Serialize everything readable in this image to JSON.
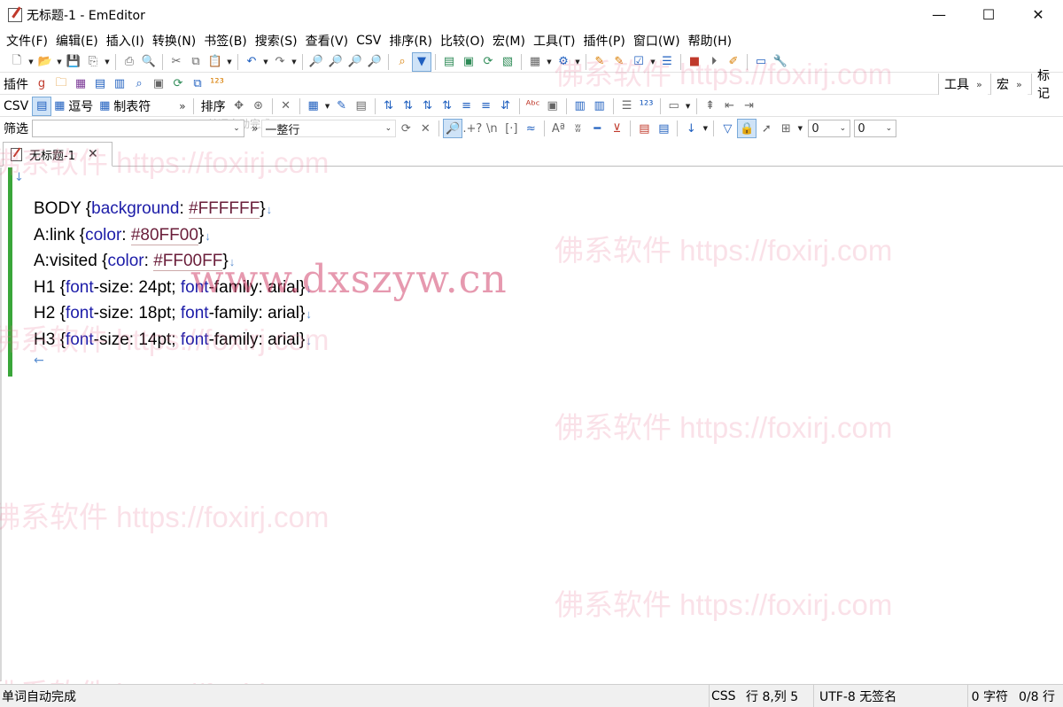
{
  "window": {
    "title": "无标题-1 - EmEditor",
    "minimize": "—",
    "maximize": "☐",
    "close": "✕"
  },
  "menu": [
    "文件(F)",
    "编辑(E)",
    "插入(I)",
    "转换(N)",
    "书签(B)",
    "搜索(S)",
    "查看(V)",
    "CSV",
    "排序(R)",
    "比较(O)",
    "宏(M)",
    "工具(T)",
    "插件(P)",
    "窗口(W)",
    "帮助(H)"
  ],
  "toolbars": {
    "plugins_label": "插件",
    "csv_label": "CSV",
    "comma_label": "逗号",
    "tab_label": "制表符",
    "sort_label": "排序",
    "filter_label": "筛选",
    "filter_mode": "一整行",
    "combo_value_1": "0",
    "combo_value_2": "0",
    "ghost_hint": "单词自动完成",
    "right_tabs": [
      "工具",
      "宏",
      "标记"
    ]
  },
  "document": {
    "tab_title": "无标题-1",
    "lines": [
      {
        "selector": "BODY ",
        "open": "{",
        "parts": [
          {
            "t": "prop",
            "v": "background"
          },
          {
            "t": "plain",
            "v": ": "
          },
          {
            "t": "hex",
            "v": "#FFFFFF"
          }
        ],
        "close": "}"
      },
      {
        "selector": "A:link ",
        "open": "{",
        "parts": [
          {
            "t": "prop",
            "v": "color"
          },
          {
            "t": "plain",
            "v": ": "
          },
          {
            "t": "hex",
            "v": "#80FF00"
          }
        ],
        "close": "}"
      },
      {
        "selector": "A:visited ",
        "open": "{",
        "parts": [
          {
            "t": "prop",
            "v": "color"
          },
          {
            "t": "plain",
            "v": ": "
          },
          {
            "t": "hex",
            "v": "#FF00FF"
          }
        ],
        "close": "}"
      },
      {
        "selector": "H1 ",
        "open": "{",
        "parts": [
          {
            "t": "prop",
            "v": "font"
          },
          {
            "t": "plain",
            "v": "-size: 24pt; "
          },
          {
            "t": "prop",
            "v": "font"
          },
          {
            "t": "plain",
            "v": "-family: arial"
          }
        ],
        "close": "}"
      },
      {
        "selector": "H2 ",
        "open": "{",
        "parts": [
          {
            "t": "prop",
            "v": "font"
          },
          {
            "t": "plain",
            "v": "-size: 18pt; "
          },
          {
            "t": "prop",
            "v": "font"
          },
          {
            "t": "plain",
            "v": "-family: arial"
          }
        ],
        "close": "}"
      },
      {
        "selector": "H3 ",
        "open": "{",
        "parts": [
          {
            "t": "prop",
            "v": "font"
          },
          {
            "t": "plain",
            "v": "-size: 14pt; "
          },
          {
            "t": "prop",
            "v": "font"
          },
          {
            "t": "plain",
            "v": "-family: arial"
          }
        ],
        "close": "}"
      }
    ],
    "eol_glyph": "↓",
    "eof_glyph": "←"
  },
  "watermarks": {
    "text": "佛系软件 https://foxirj.com",
    "big": "www.dxszyw.cn"
  },
  "status": {
    "message": "单词自动完成",
    "syntax": "CSS",
    "position": "行 8,列 5",
    "encoding": "UTF-8 无签名",
    "chars": "0 字符",
    "lines": "0/8 行"
  },
  "colors": {
    "property": "#1c1ca8",
    "hex_value": "#6a1e3a",
    "change_bar": "#3aa63a",
    "watermark": "#e6789a"
  }
}
